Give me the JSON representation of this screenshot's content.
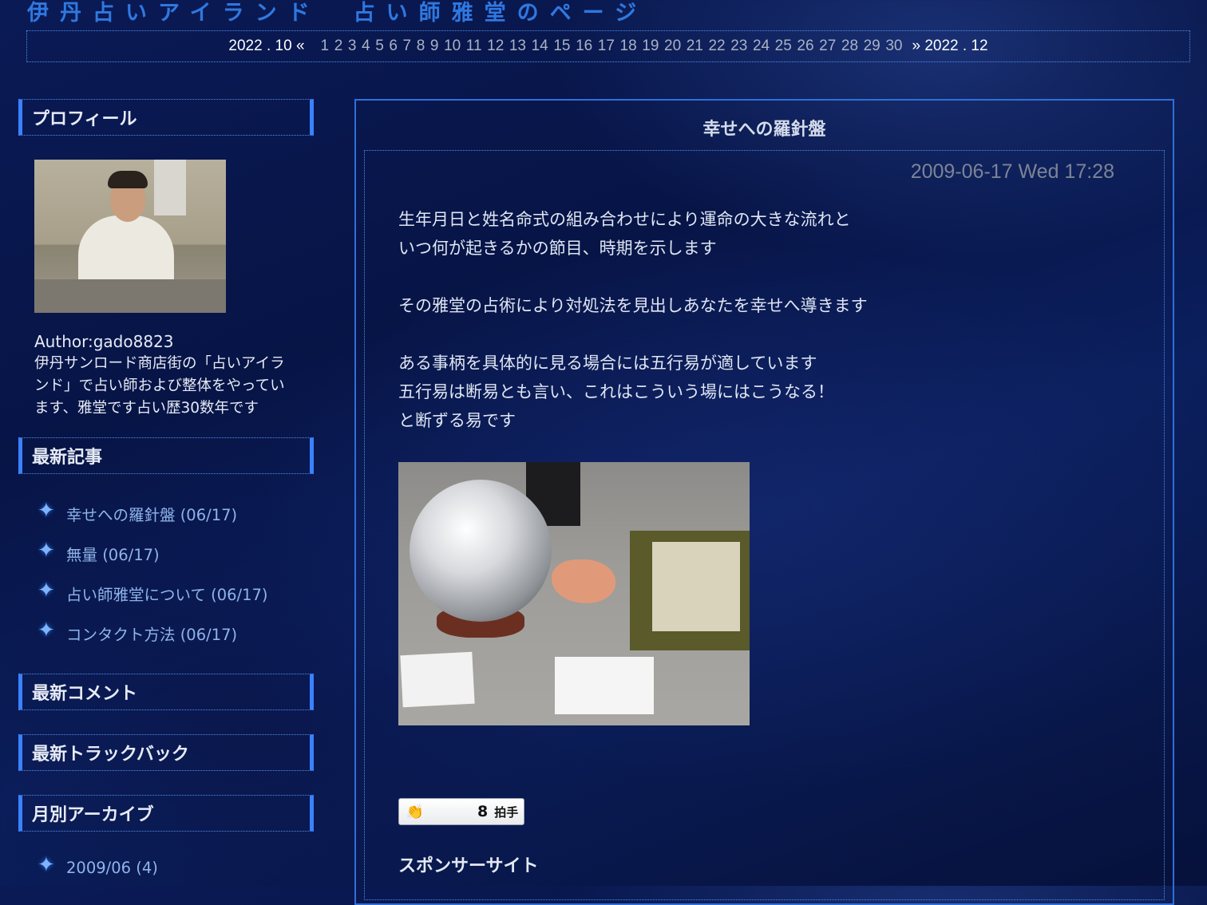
{
  "site": {
    "title": "伊丹占いアイランド　占い師雅堂のページ"
  },
  "calendar": {
    "prev": "2022 . 10 «",
    "next": "» 2022 . 12",
    "days": [
      "1",
      "2",
      "3",
      "4",
      "5",
      "6",
      "7",
      "8",
      "9",
      "10",
      "11",
      "12",
      "13",
      "14",
      "15",
      "16",
      "17",
      "18",
      "19",
      "20",
      "21",
      "22",
      "23",
      "24",
      "25",
      "26",
      "27",
      "28",
      "29",
      "30"
    ]
  },
  "sidebar": {
    "profile": {
      "heading": "プロフィール",
      "author": "Author:gado8823",
      "description": "伊丹サンロード商店街の「占いアイランド」で占い師および整体をやっています、雅堂です占い歴30数年です"
    },
    "recent_posts": {
      "heading": "最新記事",
      "items": [
        "幸せへの羅針盤 (06/17)",
        "無量 (06/17)",
        "占い師雅堂について (06/17)",
        "コンタクト方法 (06/17)"
      ]
    },
    "recent_comments": {
      "heading": "最新コメント"
    },
    "recent_trackbacks": {
      "heading": "最新トラックバック"
    },
    "archives": {
      "heading": "月別アーカイブ",
      "items": [
        "2009/06 (4)"
      ]
    }
  },
  "entry": {
    "title": "幸せへの羅針盤",
    "date": "2009-06-17 Wed 17:28",
    "paragraphs": [
      [
        "生年月日と姓名命式の組み合わせにより運命の大きな流れと",
        "いつ何が起きるかの節目、時期を示します"
      ],
      [
        "その雅堂の占術により対処法を見出しあなたを幸せへ導きます"
      ],
      [
        "ある事柄を具体的に見る場合には五行易が適しています",
        "五行易は断易とも言い、これはこういう場にはこうなる！",
        "と断ずる易です"
      ]
    ],
    "clap": {
      "count": "8",
      "label": "拍手"
    },
    "sponsor": "スポンサーサイト"
  }
}
